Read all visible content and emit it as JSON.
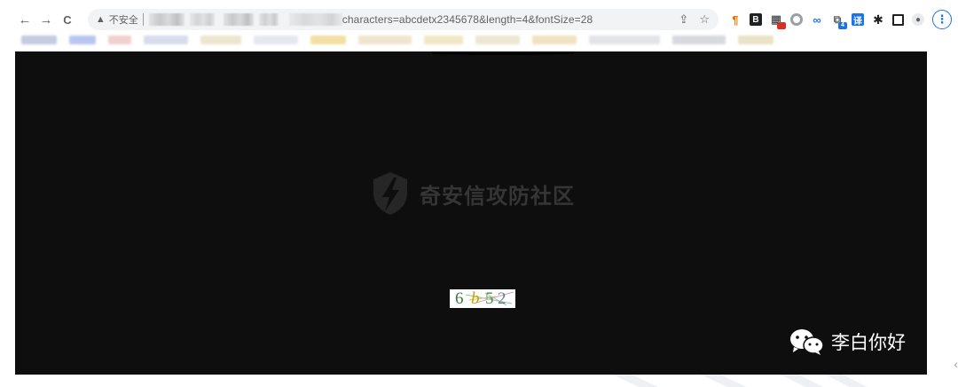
{
  "browser": {
    "nav": {
      "back_icon": "←",
      "forward_icon": "→",
      "reload_icon": "C"
    },
    "address_bar": {
      "security_icon": "▲",
      "security_label": "不安全",
      "url_visible": "characters=abcdetx2345678&length=4&fontSize=28"
    },
    "toolbar_icons": {
      "share_icon": "⇪",
      "star_icon": "☆"
    },
    "extensions": [
      {
        "name": "pilcrow",
        "glyph": "¶"
      },
      {
        "name": "b-ext",
        "glyph": "B"
      },
      {
        "name": "grid-ext",
        "glyph": "▦"
      },
      {
        "name": "circle-ext",
        "glyph": ""
      },
      {
        "name": "infinity-ext",
        "glyph": "∞"
      },
      {
        "name": "tab-ext",
        "glyph": "⧉"
      },
      {
        "name": "translate-ext",
        "glyph": "译"
      },
      {
        "name": "puzzle-ext",
        "glyph": "✱"
      },
      {
        "name": "panel-ext",
        "glyph": ""
      },
      {
        "name": "profile",
        "glyph": "●"
      }
    ],
    "tab_ext_badge": "4",
    "menu_icon": "⋮"
  },
  "content": {
    "watermark_text": "奇安信攻防社区",
    "captcha_chars": [
      "6",
      "b",
      "5",
      "2"
    ],
    "wechat_account": "李白你好"
  },
  "colors": {
    "page_bg": "#0e0e0e",
    "accent": "#1a73e8",
    "captcha_colors": [
      "#3b7a3b",
      "#c8a000",
      "#4a8f4a",
      "#6c7a89"
    ]
  }
}
